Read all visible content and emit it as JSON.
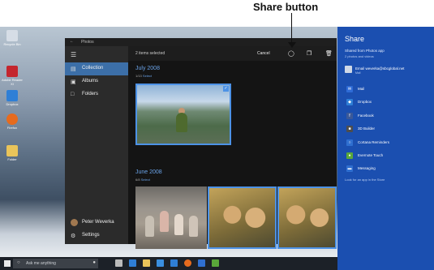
{
  "annotation": {
    "label": "Share button"
  },
  "desktop": {
    "icons": [
      {
        "name": "recycle-bin",
        "label": "Recycle Bin",
        "color": "#d6dde6"
      },
      {
        "name": "adobe-reader",
        "label": "Adobe Reader XI",
        "color": "#c4262e"
      },
      {
        "name": "dropbox",
        "label": "Dropbox",
        "color": "#2f7fd6"
      },
      {
        "name": "firefox",
        "label": "Firefox",
        "color": "#e66b1e"
      },
      {
        "name": "folder",
        "label": "Folder",
        "color": "#e9c45a"
      }
    ]
  },
  "photos": {
    "window_title": "Photos",
    "toolbar": {
      "selected": "2 items selected",
      "cancel": "Cancel"
    },
    "nav": [
      {
        "label": "Collection",
        "icon": "collection-icon"
      },
      {
        "label": "Albums",
        "icon": "albums-icon"
      },
      {
        "label": "Folders",
        "icon": "folders-icon"
      }
    ],
    "user": "Peter Weverka",
    "settings": "Settings",
    "sections": [
      {
        "title": "July 2008",
        "count": "1/13",
        "action": "Select"
      },
      {
        "title": "June 2008",
        "count": "6/8",
        "action": "Select"
      }
    ]
  },
  "share": {
    "title": "Share",
    "from": "Shared from Photos app",
    "count": "2 photos and videos",
    "email": "Email weverka@sbcglobal.net",
    "email_sub": "Mail",
    "apps": [
      {
        "label": "Mail",
        "icon": "mail-icon",
        "color": "#2e6bd6"
      },
      {
        "label": "Dropbox",
        "icon": "dropbox-icon",
        "color": "#2f7fd6"
      },
      {
        "label": "Facebook",
        "icon": "facebook-icon",
        "color": "#3b5998"
      },
      {
        "label": "3D Builder",
        "icon": "3d-builder-icon",
        "color": "#4d4d4d"
      },
      {
        "label": "Cortana Reminders",
        "icon": "cortana-icon",
        "color": "#2f6fd0"
      },
      {
        "label": "Evernote Touch",
        "icon": "evernote-icon",
        "color": "#5aa83a"
      },
      {
        "label": "Messaging",
        "icon": "messaging-icon",
        "color": "#2f6fd0"
      }
    ],
    "store": "Look for an app in the Store"
  },
  "taskbar": {
    "search_placeholder": "Ask me anything"
  }
}
